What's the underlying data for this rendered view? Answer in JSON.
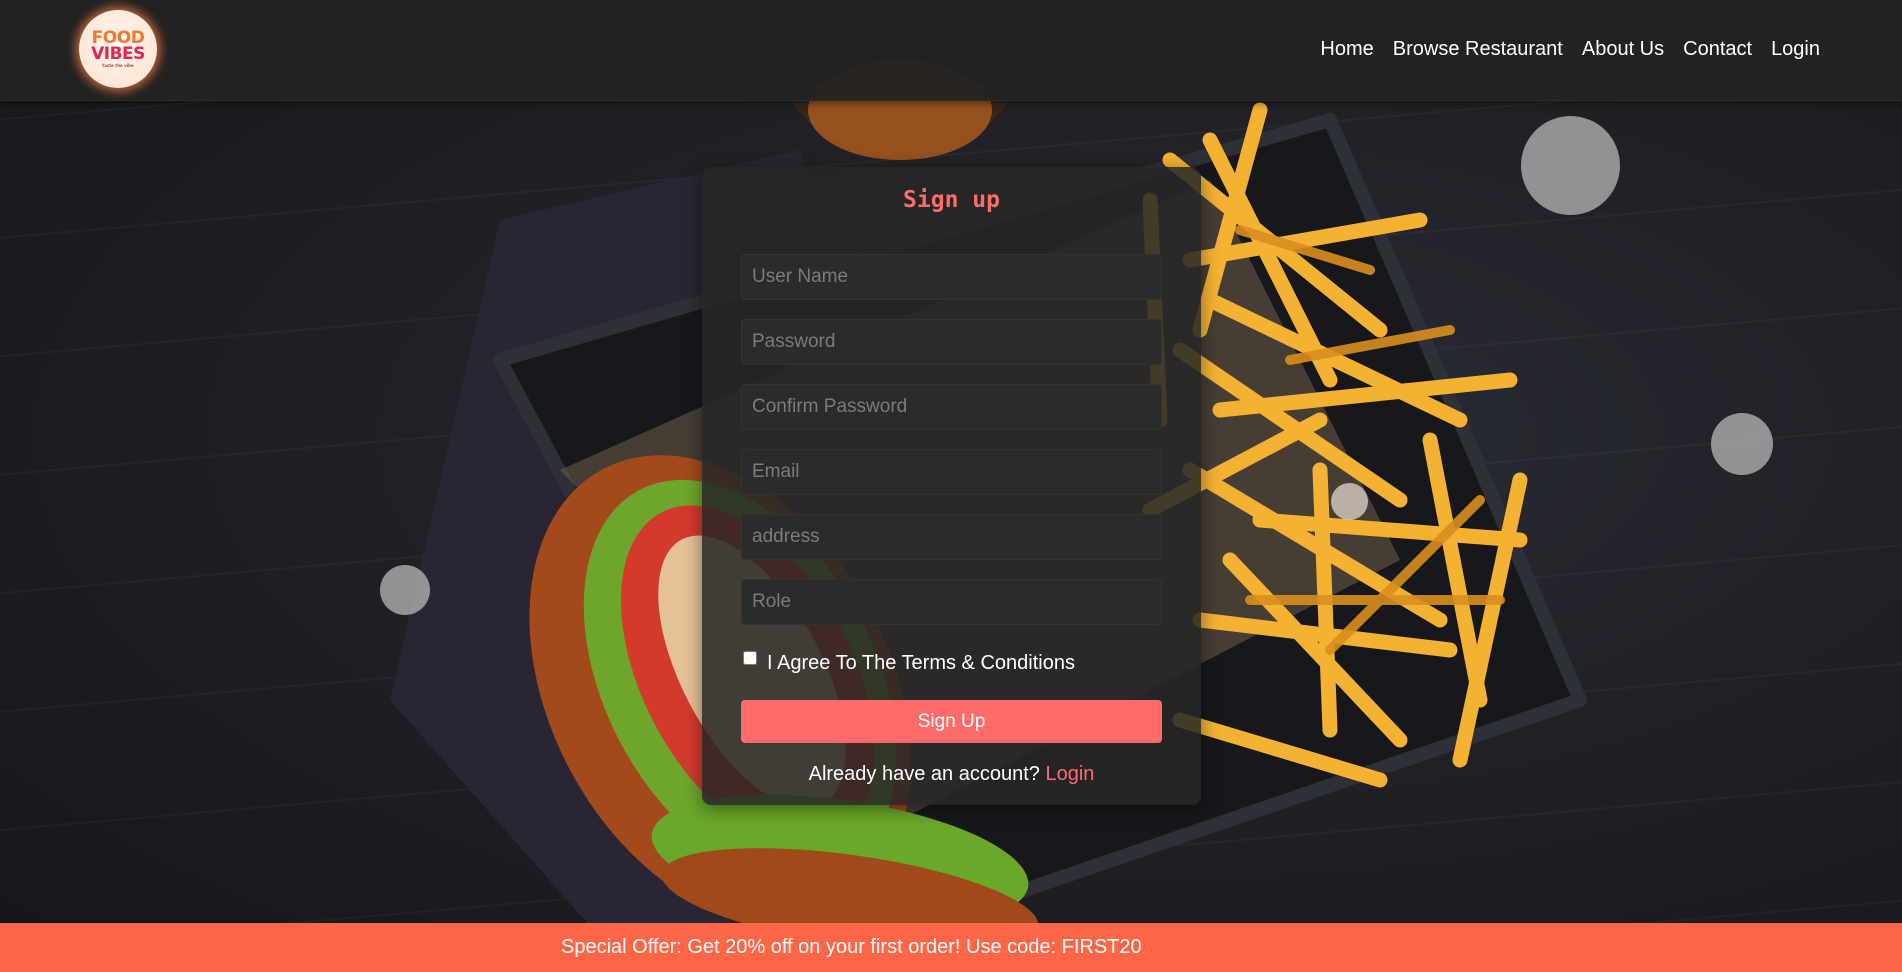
{
  "header": {
    "logo": {
      "line1": "FOOD",
      "line2": "VIBES",
      "tagline": "taste the vibe"
    },
    "nav": [
      {
        "label": "Home"
      },
      {
        "label": "Browse Restaurant"
      },
      {
        "label": "About Us"
      },
      {
        "label": "Contact"
      },
      {
        "label": "Login"
      }
    ]
  },
  "signup": {
    "title": "Sign up",
    "fields": {
      "username": {
        "placeholder": "User Name",
        "value": ""
      },
      "password": {
        "placeholder": "Password",
        "value": ""
      },
      "confirm_password": {
        "placeholder": "Confirm Password",
        "value": ""
      },
      "email": {
        "placeholder": "Email",
        "value": ""
      },
      "address": {
        "placeholder": "address",
        "value": ""
      },
      "role": {
        "placeholder": "Role",
        "value": ""
      }
    },
    "terms_label": "I Agree To The Terms & Conditions",
    "terms_checked": false,
    "submit_label": "Sign Up",
    "already_text": "Already have an account?",
    "login_link": "Login"
  },
  "offer_bar": {
    "text": "Special Offer: Get 20% off on your first order! Use code: FIRST20"
  },
  "colors": {
    "accent": "#ff6b6b",
    "offer_bar": "#ff6647",
    "header_bg": "#222222",
    "card_bg": "#262626"
  }
}
